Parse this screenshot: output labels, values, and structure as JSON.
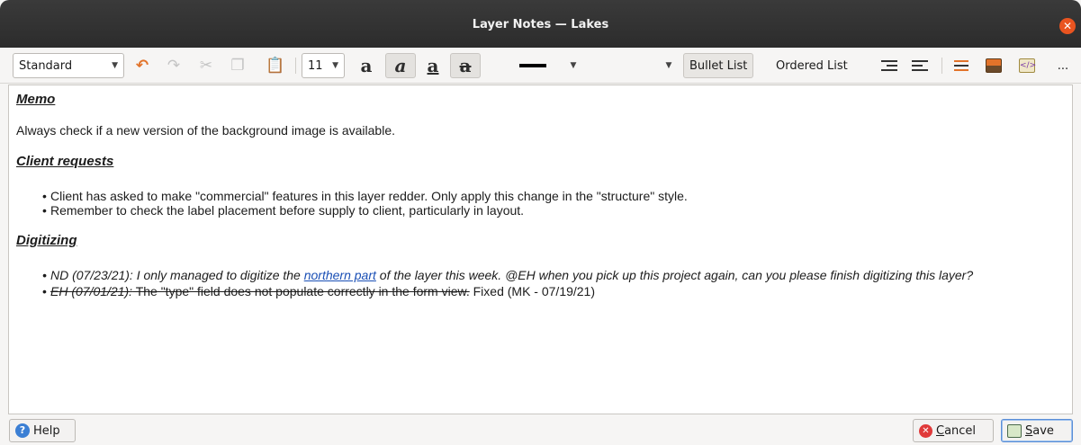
{
  "window": {
    "title": "Layer Notes — Lakes"
  },
  "toolbar": {
    "style_combo": "Standard",
    "font_size": "11",
    "bullet_list": "Bullet List",
    "ordered_list": "Ordered List",
    "overflow": "...",
    "icons": [
      "undo-icon",
      "redo-icon",
      "cut-icon",
      "copy-icon",
      "paste-icon",
      "bold-icon",
      "italic-icon",
      "underline-icon",
      "strikethrough-icon",
      "decrease-indent-icon",
      "increase-indent-icon",
      "insert-horizontal-rule-icon",
      "insert-image-icon",
      "edit-source-icon"
    ],
    "colors": {
      "accent": "#e95420",
      "undo": "#e2732a"
    }
  },
  "notes": {
    "memo_heading": "Memo",
    "memo_text": "Always check if a new version of the background image is available.",
    "client_heading": "Client requests",
    "client_items": [
      "Client has asked to make \"commercial\" features in this layer redder. Only apply this change in the \"structure\" style.",
      " Remember to check the label placement before supply to client, particularly in layout."
    ],
    "digitizing_heading": "Digitizing",
    "dig_item1_before": "ND (07/23/21): I only managed to digitize the ",
    "dig_item1_link": "northern part",
    "dig_item1_after": " of the layer this week. @EH when you pick up this project again, can you please finish digitizing this layer?",
    "dig_item2_italic_strike": "EH (07/01/21):",
    "dig_item2_strike": " The \"type\" field does not populate correctly in the form view.",
    "dig_item2_plain": " Fixed (MK - 07/19/21)"
  },
  "buttons": {
    "help": "Help",
    "cancel_prefix": "C",
    "cancel_rest": "ancel",
    "save_prefix": "S",
    "save_rest": "ave"
  }
}
